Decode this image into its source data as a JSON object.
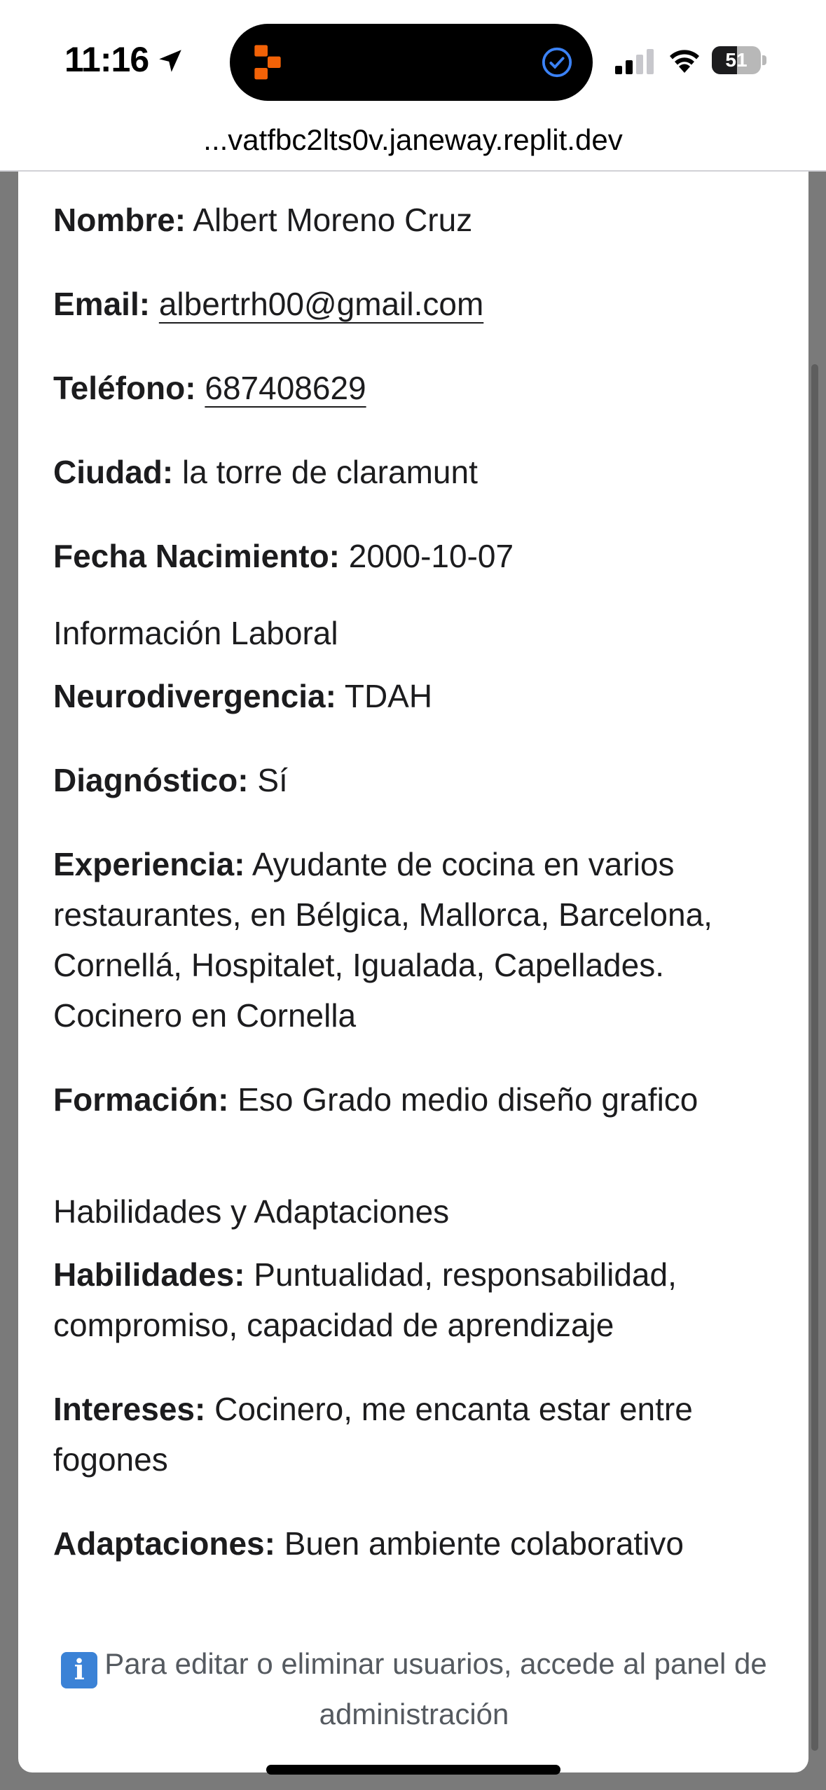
{
  "status_bar": {
    "time": "11:16",
    "battery_level": "51",
    "battery_fraction": 0.51
  },
  "browser": {
    "url": "...vatfbc2lts0v.janeway.replit.dev"
  },
  "profile": {
    "personal": [
      {
        "label": "Nombre:",
        "value": "Albert Moreno Cruz",
        "link": false
      },
      {
        "label": "Email:",
        "value": "albertrh00@gmail.com",
        "link": true
      },
      {
        "label": "Teléfono:",
        "value": "687408629",
        "link": true
      },
      {
        "label": "Ciudad:",
        "value": "la torre de claramunt",
        "link": false
      },
      {
        "label": "Fecha Nacimiento:",
        "value": "2000-10-07",
        "link": false
      }
    ],
    "work_section_title": "Información Laboral",
    "work": [
      {
        "label": "Neurodivergencia:",
        "value": "TDAH"
      },
      {
        "label": "Diagnóstico:",
        "value": "Sí"
      },
      {
        "label": "Experiencia:",
        "value": "Ayudante de cocina en varios restaurantes, en Bélgica, Mallorca, Barcelona, Cornellá, Hospitalet, Igualada, Capellades. Cocinero en Cornella"
      },
      {
        "label": "Formación:",
        "value": "Eso Grado medio diseño grafico"
      }
    ],
    "skills_section_title": "Habilidades y Adaptaciones",
    "skills": [
      {
        "label": "Habilidades:",
        "value": "Puntualidad, responsabilidad, compromiso, capacidad de aprendizaje"
      },
      {
        "label": "Intereses:",
        "value": "Cocinero, me encanta estar entre fogones"
      },
      {
        "label": "Adaptaciones:",
        "value": "Buen ambiente colaborativo"
      }
    ]
  },
  "note": {
    "icon": "info-icon",
    "text": "Para editar o eliminar usuarios, accede al panel de administración"
  },
  "colors": {
    "backdrop": "#7a7a7a",
    "text": "#1c1c1e",
    "note_text": "#555a60",
    "info_icon": "#3b82d6",
    "replit_orange": "#f26207"
  }
}
